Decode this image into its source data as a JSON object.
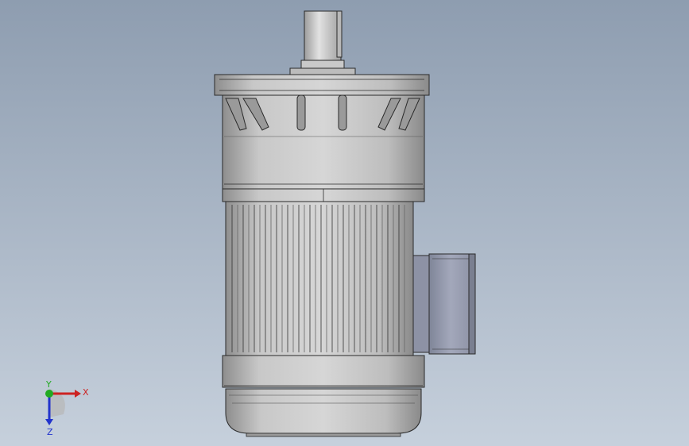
{
  "viewport": {
    "background_top": "#8e9db0",
    "background_bottom": "#c6d0dc"
  },
  "model": {
    "part_color": "#c4c4c4",
    "shadow_color": "#8a8a8a",
    "edge_color": "#2a2a2a",
    "terminal_box_color": "#9aa0b4"
  },
  "triad": {
    "x_label": "X",
    "y_label": "Y",
    "z_label": "Z",
    "x_color": "#cc2222",
    "y_color": "#22aa22",
    "z_color": "#2233cc"
  }
}
